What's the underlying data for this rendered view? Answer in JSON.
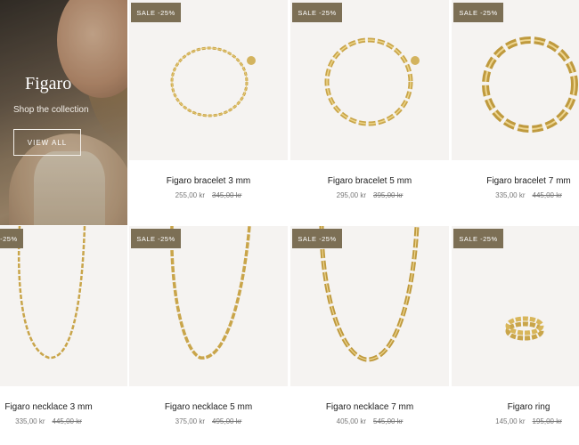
{
  "hero": {
    "title": "Figaro",
    "subtitle": "Shop the collection",
    "button": "VIEW ALL"
  },
  "badge_text": "SALE -25%",
  "products": [
    {
      "name": "Figaro bracelet 3 mm",
      "price": "255,00 kr",
      "old_price": "345,00 kr",
      "image": "bracelet-thin"
    },
    {
      "name": "Figaro bracelet 5 mm",
      "price": "295,00 kr",
      "old_price": "395,00 kr",
      "image": "bracelet-medium"
    },
    {
      "name": "Figaro bracelet 7 mm",
      "price": "335,00 kr",
      "old_price": "445,00 kr",
      "image": "bracelet-thick"
    },
    {
      "name": "Figaro necklace 3 mm",
      "price": "335,00 kr",
      "old_price": "445,00 kr",
      "image": "necklace-thin"
    },
    {
      "name": "Figaro necklace 5 mm",
      "price": "375,00 kr",
      "old_price": "495,00 kr",
      "image": "necklace-medium"
    },
    {
      "name": "Figaro necklace 7 mm",
      "price": "405,00 kr",
      "old_price": "545,00 kr",
      "image": "necklace-thick"
    },
    {
      "name": "Figaro ring",
      "price": "145,00 kr",
      "old_price": "195,00 kr",
      "image": "ring"
    }
  ],
  "colors": {
    "badge": "#7c6f55",
    "image_bg": "#f5f3f1",
    "gold": "#c9a54a"
  }
}
